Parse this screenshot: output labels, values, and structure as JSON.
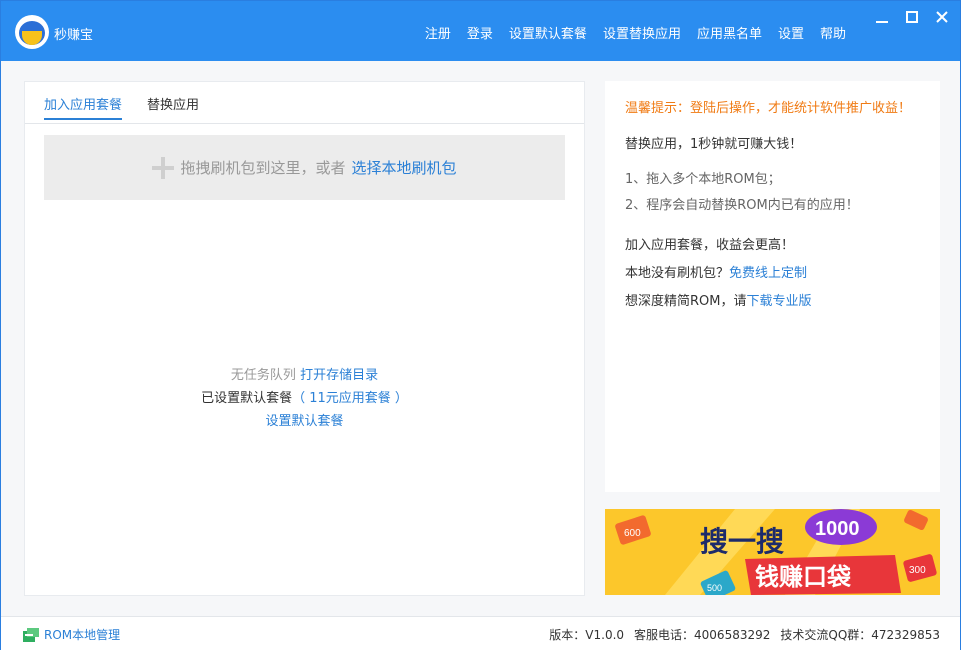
{
  "app": {
    "name": "秒赚宝"
  },
  "menu": [
    "注册",
    "登录",
    "设置默认套餐",
    "设置替换应用",
    "应用黑名单",
    "设置",
    "帮助"
  ],
  "tabs": {
    "add": "加入应用套餐",
    "replace": "替换应用"
  },
  "dropzone": {
    "text": "拖拽刷机包到这里，或者",
    "link": "选择本地刷机包"
  },
  "queue": {
    "empty": "无任务队列",
    "open_dir": "打开存储目录"
  },
  "package": {
    "label": "已设置默认套餐",
    "value": "（ 11元应用套餐 ）",
    "set_link": "设置默认套餐"
  },
  "tips": {
    "warning": "温馨提示：登陆后操作，才能统计软件推广收益！",
    "headline": "替换应用，1秒钟就可赚大钱！",
    "step1": "1、拖入多个本地ROM包；",
    "step2": "2、程序会自动替换ROM内已有的应用！",
    "add_pkg": "加入应用套餐，收益会更高！",
    "no_pkg_text": "本地没有刷机包？",
    "no_pkg_link": "免费线上定制",
    "deep_text": "想深度精简ROM，请",
    "deep_link": "下载专业版"
  },
  "banner": {
    "line1": "搜一搜",
    "badge": "1000",
    "line2": "钱赚口袋",
    "chip_left": "600",
    "chip_right": "300",
    "chip_bottom": "500"
  },
  "footer": {
    "rom_manage": "ROM本地管理",
    "version": "版本：V1.0.0",
    "phone": "客服电话：4006583292",
    "qq": "技术交流QQ群：472329853"
  },
  "colors": {
    "titlebar": "#2b8df0",
    "link": "#2b80d6",
    "warning": "#f07b14",
    "banner": "#fcc72b"
  }
}
